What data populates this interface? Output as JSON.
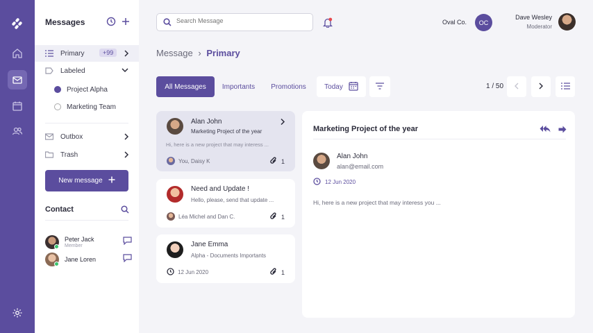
{
  "sidebar": {
    "title": "Messages",
    "items": [
      {
        "label": "Primary",
        "badge": "+99"
      },
      {
        "label": "Labeled"
      },
      {
        "label": "Project Alpha"
      },
      {
        "label": "Marketing Team"
      },
      {
        "label": "Outbox"
      },
      {
        "label": "Trash"
      }
    ],
    "new_message": "New message",
    "contact_title": "Contact",
    "contacts": [
      {
        "name": "Peter Jack",
        "role": "Member"
      },
      {
        "name": "Jane Loren",
        "role": ""
      }
    ]
  },
  "header": {
    "search_placeholder": "Search Message",
    "company": "Oval Co.",
    "company_initials": "OC",
    "user_name": "Dave Wesley",
    "user_role": "Moderator"
  },
  "breadcrumb": {
    "root": "Message",
    "current": "Primary"
  },
  "tabs": [
    {
      "label": "All Messages",
      "active": true
    },
    {
      "label": "Importants"
    },
    {
      "label": "Promotions"
    }
  ],
  "filter": {
    "date_label": "Today"
  },
  "pagination": {
    "label": "1 / 50"
  },
  "messages": [
    {
      "name": "Alan John",
      "subject": "Marketing Project of the year",
      "preview": "Hi, here is a new project that may interess ...",
      "footer": "You, Daisy K",
      "attachments": "1"
    },
    {
      "name": "Need and Update !",
      "subject": "Hello, please, send that update ...",
      "footer": "Léa Michel and Dan C.",
      "attachments": "1"
    },
    {
      "name": "Jane Emma",
      "subject": "Alpha - Documents Importants",
      "footer": "12 Jun 2020",
      "attachments": "1"
    }
  ],
  "detail": {
    "title": "Marketing Project of the year",
    "sender_name": "Alan John",
    "sender_email": "alan@email.com",
    "date": "12 Jun 2020",
    "body": "Hi, here is a new project that may interess you ..."
  },
  "colors": {
    "accent": "#5b4d9e",
    "online": "#3cc46f",
    "notification": "#e8474c"
  }
}
